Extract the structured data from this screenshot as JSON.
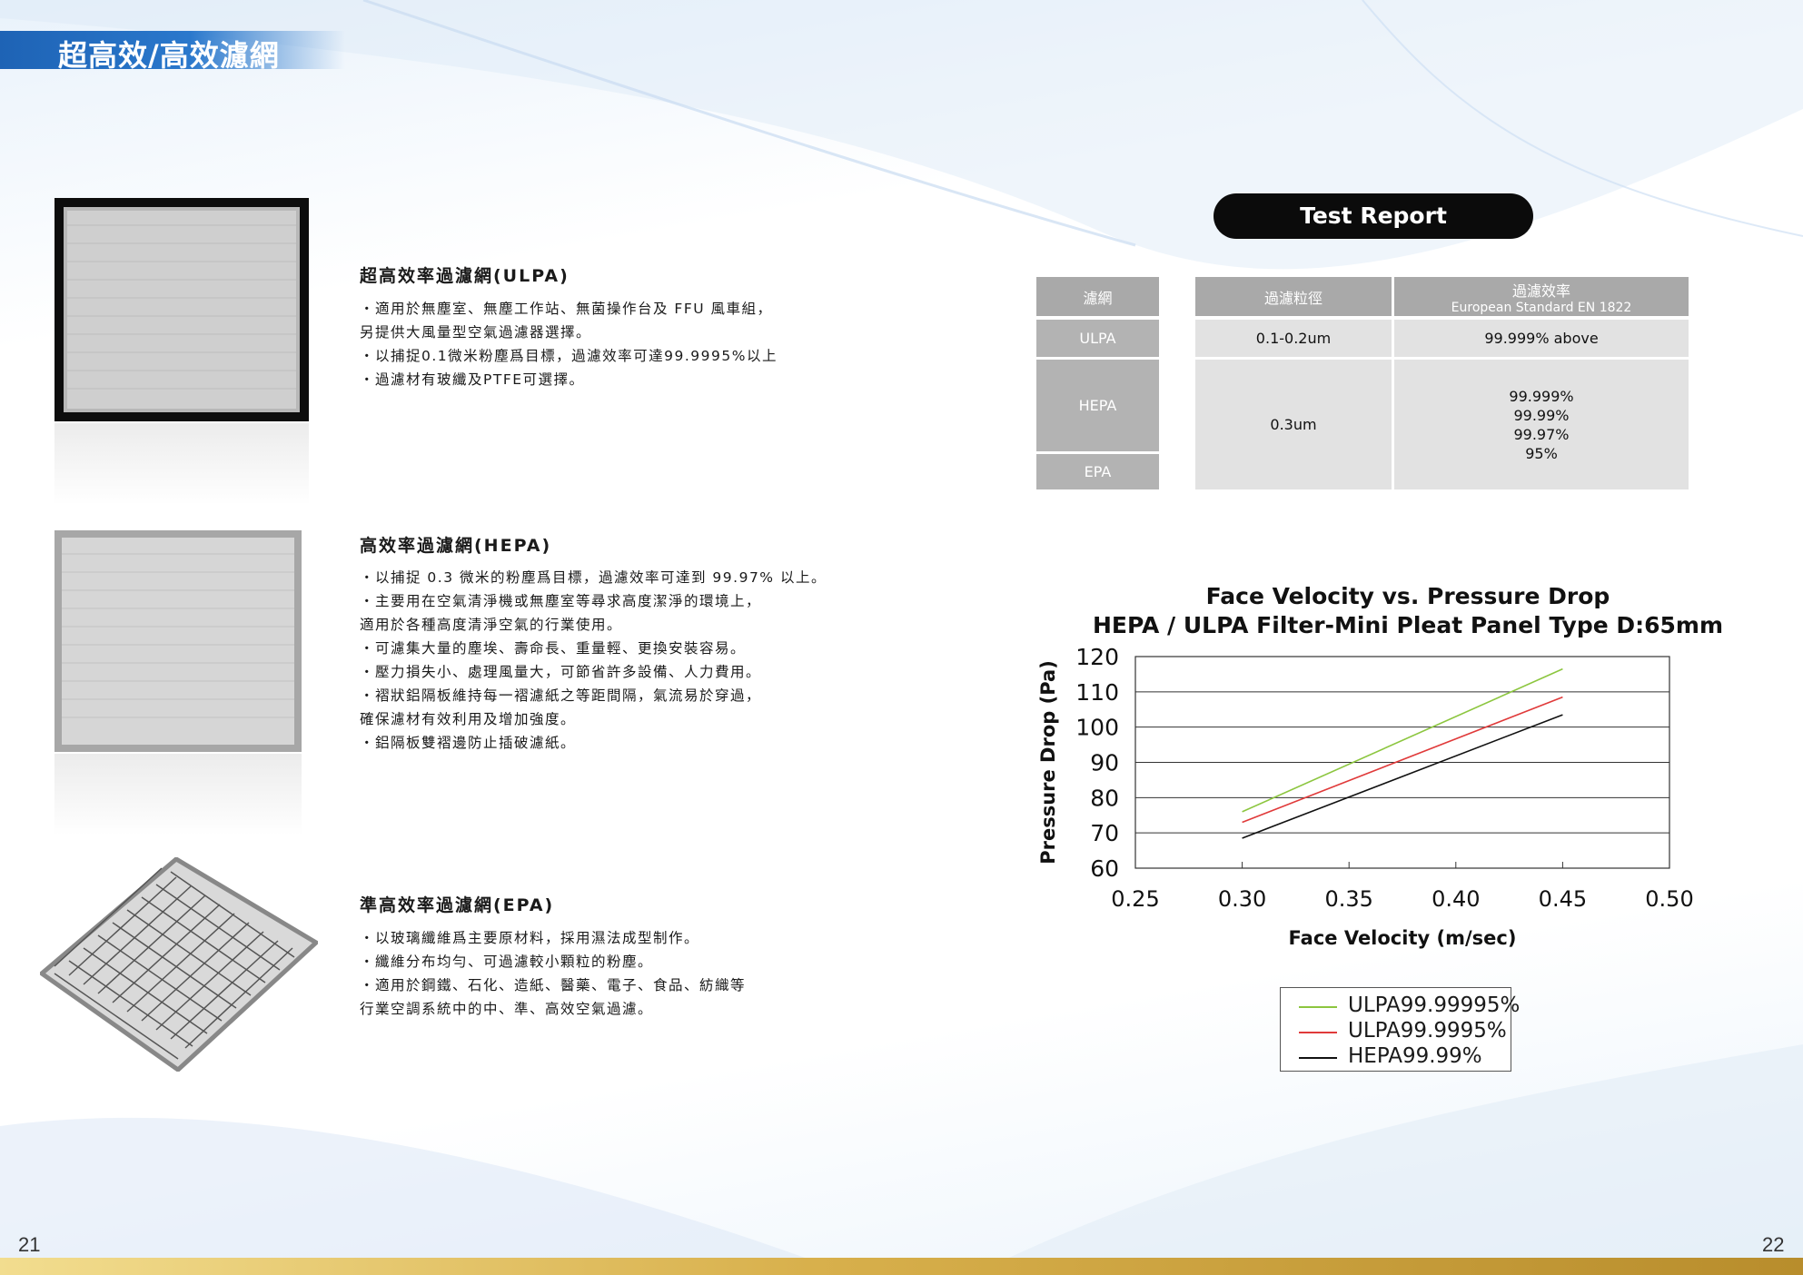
{
  "header": {
    "title": "超高效/高效濾網"
  },
  "pages": {
    "left": "21",
    "right": "22"
  },
  "products": [
    {
      "title": "超高效率過濾網(ULPA)",
      "lines": [
        "・適用於無塵室、無塵工作站、無菌操作台及 FFU 風車組，",
        "  另提供大風量型空氣過濾器選擇。",
        "・以捕捉0.1微米粉塵爲目標，過濾效率可達99.9995%以上",
        "・過濾材有玻纖及PTFE可選擇。"
      ]
    },
    {
      "title": "高效率過濾網(HEPA)",
      "lines": [
        "・以捕捉 0.3 微米的粉塵爲目標，過濾效率可達到 99.97% 以上。",
        "・主要用在空氣清淨機或無塵室等尋求高度潔淨的環境上，",
        "  適用於各種高度清淨空氣的行業使用。",
        "・可濾集大量的塵埃、壽命長、重量輕、更換安裝容易。",
        "・壓力損失小、處理風量大，可節省許多設備、人力費用。",
        "・褶狀鋁隔板維持每一褶濾紙之等距間隔，氣流易於穿過，",
        "  確保濾材有效利用及增加強度。",
        "・鋁隔板雙褶邊防止插破濾紙。"
      ]
    },
    {
      "title": "準高效率過濾網(EPA)",
      "lines": [
        "・以玻璃纖維爲主要原材料，採用濕法成型制作。",
        "・纖維分布均勻、可過濾較小顆粒的粉塵。",
        "・適用於鋼鐵、石化、造紙、醫藥、電子、食品、紡織等",
        "  行業空調系統中的中、準、高效空氣過濾。"
      ]
    }
  ],
  "report": {
    "title": "Test Report",
    "headers": {
      "filter": "濾網",
      "particle": "過濾粒徑",
      "efficiency": "過濾效率",
      "efficiency_sub": "European Standard EN 1822"
    },
    "ulpa": {
      "label": "ULPA",
      "particle": "0.1-0.2um",
      "efficiency": "99.999% above"
    },
    "hepa": {
      "label": "HEPA",
      "particle": "0.3um",
      "eff1": "99.999%",
      "eff2": "99.99%",
      "eff3": "99.97%",
      "eff4": "95%"
    },
    "epa": {
      "label": "EPA"
    }
  },
  "chart_data": {
    "type": "line",
    "title": "Face Velocity vs. Pressure Drop",
    "subtitle": "HEPA / ULPA Filter-Mini Pleat Panel Type D:65mm",
    "xlabel": "Face Velocity (m/sec)",
    "ylabel": "Pressure Drop (Pa)",
    "xlim": [
      0.25,
      0.5
    ],
    "ylim": [
      60,
      120
    ],
    "x_ticks": [
      "0.25",
      "0.30",
      "0.35",
      "0.40",
      "0.45",
      "0.50"
    ],
    "y_ticks": [
      "60",
      "70",
      "80",
      "90",
      "100",
      "110",
      "120"
    ],
    "grid": "horizontal",
    "legend": "bottom",
    "series": [
      {
        "name": "ULPA99.99995%",
        "color": "#8cc63f",
        "points": [
          [
            0.3,
            76
          ],
          [
            0.45,
            116.5
          ]
        ]
      },
      {
        "name": "ULPA99.9995%",
        "color": "#e03a3a",
        "points": [
          [
            0.3,
            73
          ],
          [
            0.45,
            108.5
          ]
        ]
      },
      {
        "name": "HEPA99.99%",
        "color": "#111111",
        "points": [
          [
            0.3,
            68.5
          ],
          [
            0.45,
            103.5
          ]
        ]
      }
    ]
  }
}
